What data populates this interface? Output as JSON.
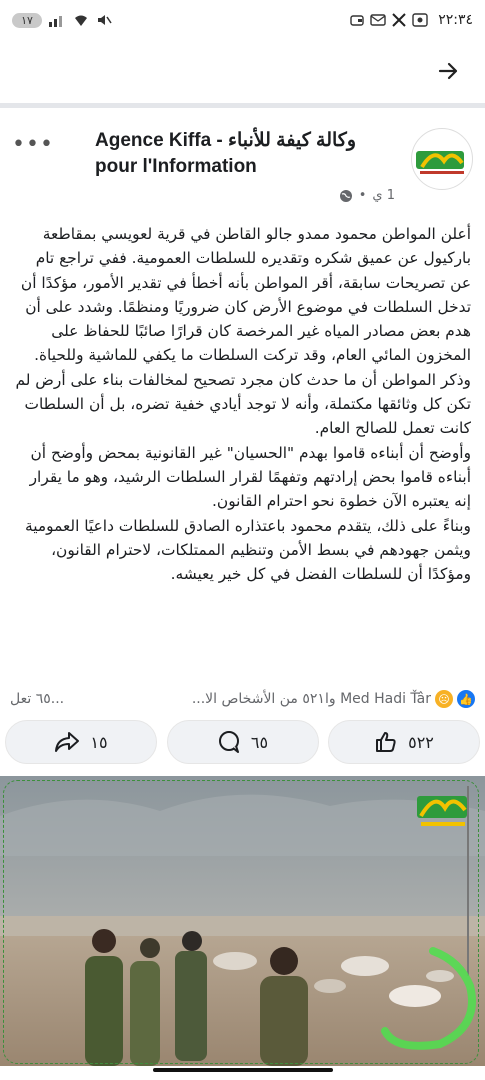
{
  "status_bar": {
    "time": "٢٢:٣٤",
    "battery": "١٧",
    "left_icons": [
      "battery-icon",
      "signal-icon",
      "wifi-icon",
      "mute-icon"
    ],
    "right_icons": [
      "wallet-icon",
      "mail-icon",
      "x-icon",
      "screen-record-icon"
    ]
  },
  "post": {
    "page_name": "Agence Kiffa - وكالة كيفة للأنباء pour l'Information",
    "time_ago": "1 ي",
    "paragraphs": [
      "أعلن المواطن محمود ممدو جالو القاطن في قرية لعويسي بمقاطعة باركيول عن عميق شكره وتقديره للسلطات العمومية. ففي تراجع تام عن تصريحات سابقة، أقر المواطن بأنه أخطأ في تقدير الأمور، مؤكدًا أن تدخل السلطات في موضوع الأرض كان ضروريًا ومنظمًا. وشدد على أن هدم بعض مصادر المياه غير المرخصة كان قرارًا صائبًا للحفاظ على المخزون المائي العام، وقد تركت السلطات ما يكفي للماشية وللحياة.",
      "وذكر المواطن أن ما حدث كان مجرد تصحيح لمخالفات بناء على أرض لم تكن كل وثائقها مكتملة، وأنه لا توجد أيادي خفية تضره، بل أن السلطات كانت تعمل للصالح العام.",
      "وأوضح أن أبناءه قاموا بهدم \"الحسيان\" غير القانونية بمحض وأوضح أن أبناءه قاموا بحض إرادتهم وتفهمًا لقرار السلطات الرشيد، وهو ما يقرار إنه يعتبره الآن خطوة نحو احترام القانون.",
      "وبناءً على ذلك، يتقدم محمود باعتذاره الصادق للسلطات داعيًا العمومية ويثمن جهودهم في بسط الأمن وتنظيم الممتلكات، لاحترام القانون، ومؤكدًا أن للسلطات الفضل في كل خير يعيشه."
    ],
    "reactions_summary": "Med Hadi Ťâr وا٥٢١ من الأشخاص الا...",
    "comments_count_text": "٦٥ تعل...",
    "like_count": "٥٢٢",
    "comment_count": "٦٥",
    "share_count": "١٥"
  },
  "colors": {
    "like_blue": "#1877f2",
    "love_red": "#f33e58",
    "haha_yellow": "#f7b125",
    "logo_green": "#2e9b3c"
  }
}
